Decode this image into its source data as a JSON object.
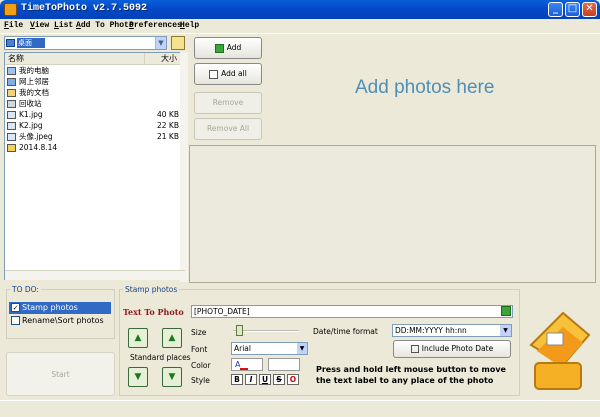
{
  "window": {
    "title": "TimeToPhoto v2.7.5092",
    "minimize": "_",
    "maximize": "□",
    "close": "✕"
  },
  "menu": [
    "File",
    "View",
    "List",
    "Add To Photo",
    "Preferences",
    "Help"
  ],
  "folder": {
    "current": "桌面"
  },
  "filelist": {
    "col_name": "名称",
    "col_size": "大小",
    "items": [
      {
        "name": "我的电脑",
        "size": "",
        "icon": "computer-icon"
      },
      {
        "name": "网上邻居",
        "size": "",
        "icon": "network-icon"
      },
      {
        "name": "我的文档",
        "size": "",
        "icon": "documents-icon"
      },
      {
        "name": "回收站",
        "size": "",
        "icon": "recycle-bin-icon"
      },
      {
        "name": "K1.jpg",
        "size": "40 KB",
        "icon": "image-icon"
      },
      {
        "name": "K2.jpg",
        "size": "22 KB",
        "icon": "image-icon"
      },
      {
        "name": "头像.jpeg",
        "size": "21 KB",
        "icon": "image-icon"
      },
      {
        "name": "2014.8.14",
        "size": "",
        "icon": "folder-icon"
      }
    ]
  },
  "actions": {
    "add": "Add",
    "add_all": "Add all",
    "remove": "Remove",
    "remove_all": "Remove All"
  },
  "drop_area": {
    "text": "Add photos here"
  },
  "todo": {
    "title": "TO DO:",
    "items": [
      {
        "label": "Stamp photos",
        "checked": true
      },
      {
        "label": "Rename\\Sort photos",
        "checked": false
      }
    ],
    "start": "Start"
  },
  "stamp": {
    "title": "Stamp photos",
    "text_to_photo_label": "Text To Photo",
    "text_value": "[PHOTO_DATE]",
    "standard_places": "Standard places",
    "size_label": "Size",
    "font_label": "Font",
    "font_value": "Arial",
    "color_label": "Color",
    "style_label": "Style",
    "style_buttons": [
      "B",
      "I",
      "U",
      "S",
      "O"
    ],
    "datetime_label": "Date/time format",
    "datetime_value": "DD:MM:YYYY hh:nn",
    "include_button": "Include Photo Date",
    "hint": "Press and hold left mouse button to move the text label to any place of the photo"
  }
}
